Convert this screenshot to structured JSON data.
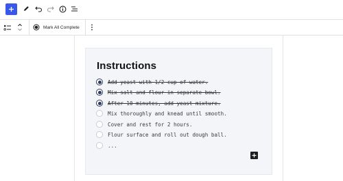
{
  "toolbar": {
    "add_icon": "plus-icon",
    "tools": [
      "pencil-icon",
      "undo-icon",
      "redo-icon",
      "info-icon",
      "list-view-icon"
    ]
  },
  "block_toolbar": {
    "mark_all_label": "Mark All Complete",
    "more_icon": "vertical-ellipsis-icon"
  },
  "card": {
    "title": "Instructions",
    "steps": [
      {
        "text": "Add yeast with 1/2 cup of water.",
        "done": true
      },
      {
        "text": "Mix salt and flour in separate bowl.",
        "done": true
      },
      {
        "text": "After 10 minutes, add yeast mixture.",
        "done": true
      },
      {
        "text": "Mix thoroughly and knead until smooth.",
        "done": false
      },
      {
        "text": "Cover and rest for 2 hours.",
        "done": false
      },
      {
        "text": "Flour surface and roll out dough ball.",
        "done": false
      },
      {
        "text": "...",
        "done": false
      }
    ]
  },
  "colors": {
    "accent": "#3858e9",
    "card_bg": "#f3f5f8",
    "checked": "#2d3a5a"
  }
}
